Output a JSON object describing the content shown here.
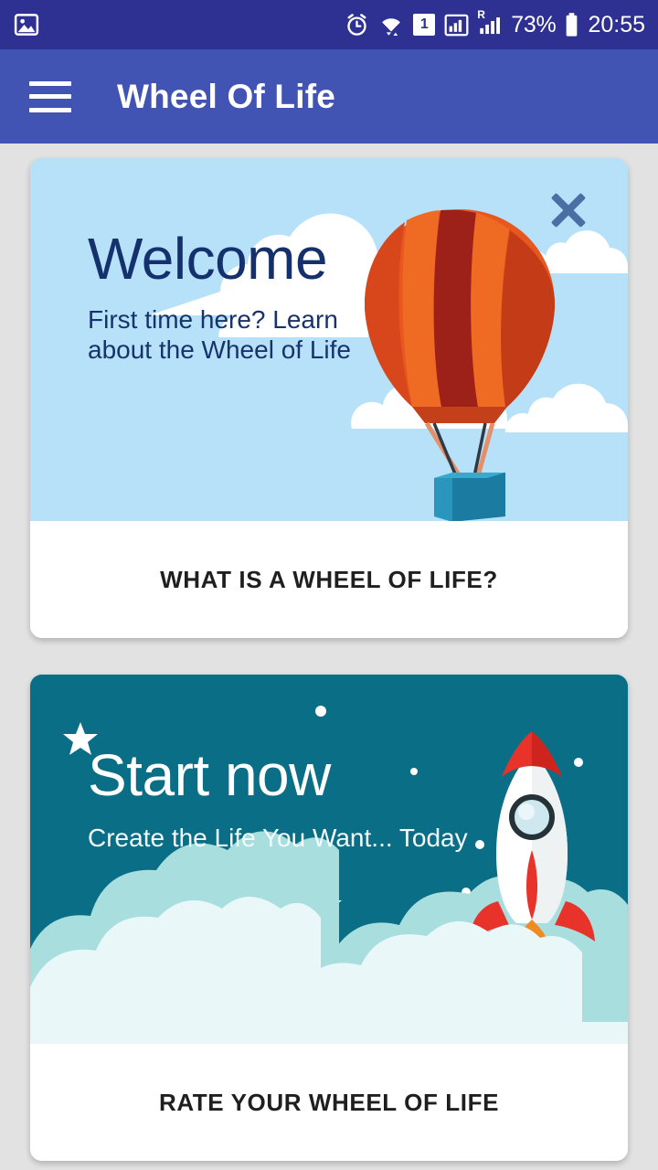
{
  "status_bar": {
    "notification_icon": "image-icon",
    "icons": [
      "alarm-icon",
      "wifi-icon",
      "sim-badge",
      "signal-icon",
      "roaming-signal-icon"
    ],
    "sim_badge": "1",
    "roaming_label": "R",
    "battery_percent": "73%",
    "time": "20:55",
    "background_color": "#2e3192"
  },
  "app_bar": {
    "menu_icon": "hamburger-menu-icon",
    "title": "Wheel Of Life",
    "background_color": "#4154b3"
  },
  "cards": [
    {
      "id": "welcome-card",
      "title": "Welcome",
      "subtitle": "First time here? Learn about the Wheel of Life",
      "close_icon": "close-x-icon",
      "illustration": "hot-air-balloon",
      "hero_background": "#b6e1f9",
      "title_color": "#14316e",
      "action_label": "WHAT IS A WHEEL OF LIFE?"
    },
    {
      "id": "start-now-card",
      "title": "Start now",
      "subtitle": "Create the Life You Want... Today",
      "illustration": "rocket-launch",
      "hero_background": "#0a6e87",
      "title_color": "#ffffff",
      "action_label": "RATE YOUR WHEEL OF LIFE"
    }
  ],
  "page": {
    "background_color": "#e2e2e2"
  }
}
